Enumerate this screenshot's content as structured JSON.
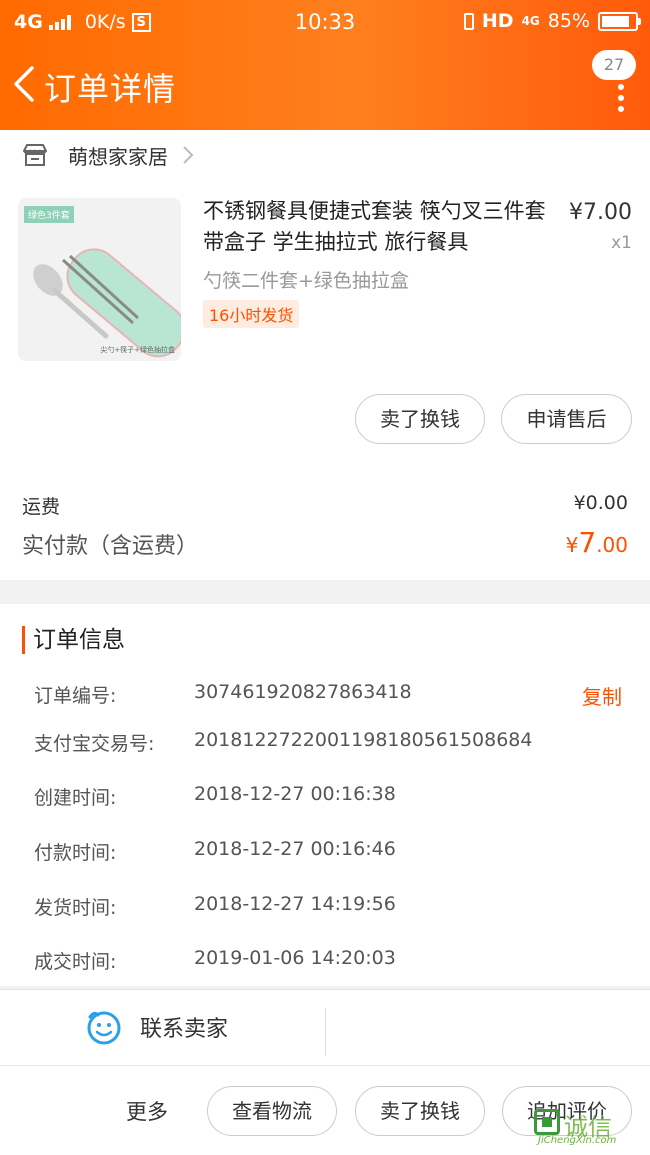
{
  "status_bar": {
    "network": "4G",
    "speed": "0K/s",
    "sim_icon": "S",
    "time": "10:33",
    "hd": "HD",
    "net2": "4G",
    "battery": "85%",
    "battery_level": 0.85
  },
  "nav": {
    "title": "订单详情",
    "badge_count": "27"
  },
  "shop": {
    "name": "萌想家家居"
  },
  "product": {
    "title": "不锈钢餐具便捷式套装 筷勺叉三件套 带盒子 学生抽拉式 旅行餐具",
    "sku": "勺筷二件套+绿色抽拉盒",
    "ship_tag": "16小时发货",
    "price": "¥7.00",
    "qty": "x1",
    "image_tag": "绿色3件套",
    "image_caption": "尖勺+筷子+绿色抽拉盒"
  },
  "product_actions": {
    "sell": "卖了换钱",
    "after_sale": "申请售后"
  },
  "summary": {
    "fee_label": "运费",
    "fee_value": "¥0.00",
    "paid_label": "实付款（含运费）",
    "paid_symbol": "¥",
    "paid_int": "7",
    "paid_dec": ".00"
  },
  "order_info": {
    "title": "订单信息",
    "copy_label": "复制",
    "rows": [
      {
        "label": "订单编号:",
        "value": "307461920827863418"
      },
      {
        "label": "支付宝交易号:",
        "value": "2018122722001198180561508684"
      },
      {
        "label": "创建时间:",
        "value": "2018-12-27 00:16:38"
      },
      {
        "label": "付款时间:",
        "value": "2018-12-27 00:16:46"
      },
      {
        "label": "发货时间:",
        "value": "2018-12-27 14:19:56"
      },
      {
        "label": "成交时间:",
        "value": "2019-01-06 14:20:03"
      }
    ]
  },
  "contact": {
    "label": "联系卖家"
  },
  "bottom": {
    "more": "更多",
    "logistics": "查看物流",
    "sell": "卖了换钱",
    "review": "追加评价"
  },
  "watermark": {
    "cn": "诚信",
    "en": "JiChengXin.com"
  },
  "colors": {
    "brand": "#ff6a00",
    "accent": "#ff5000",
    "contact_icon": "#2aa0e8"
  }
}
